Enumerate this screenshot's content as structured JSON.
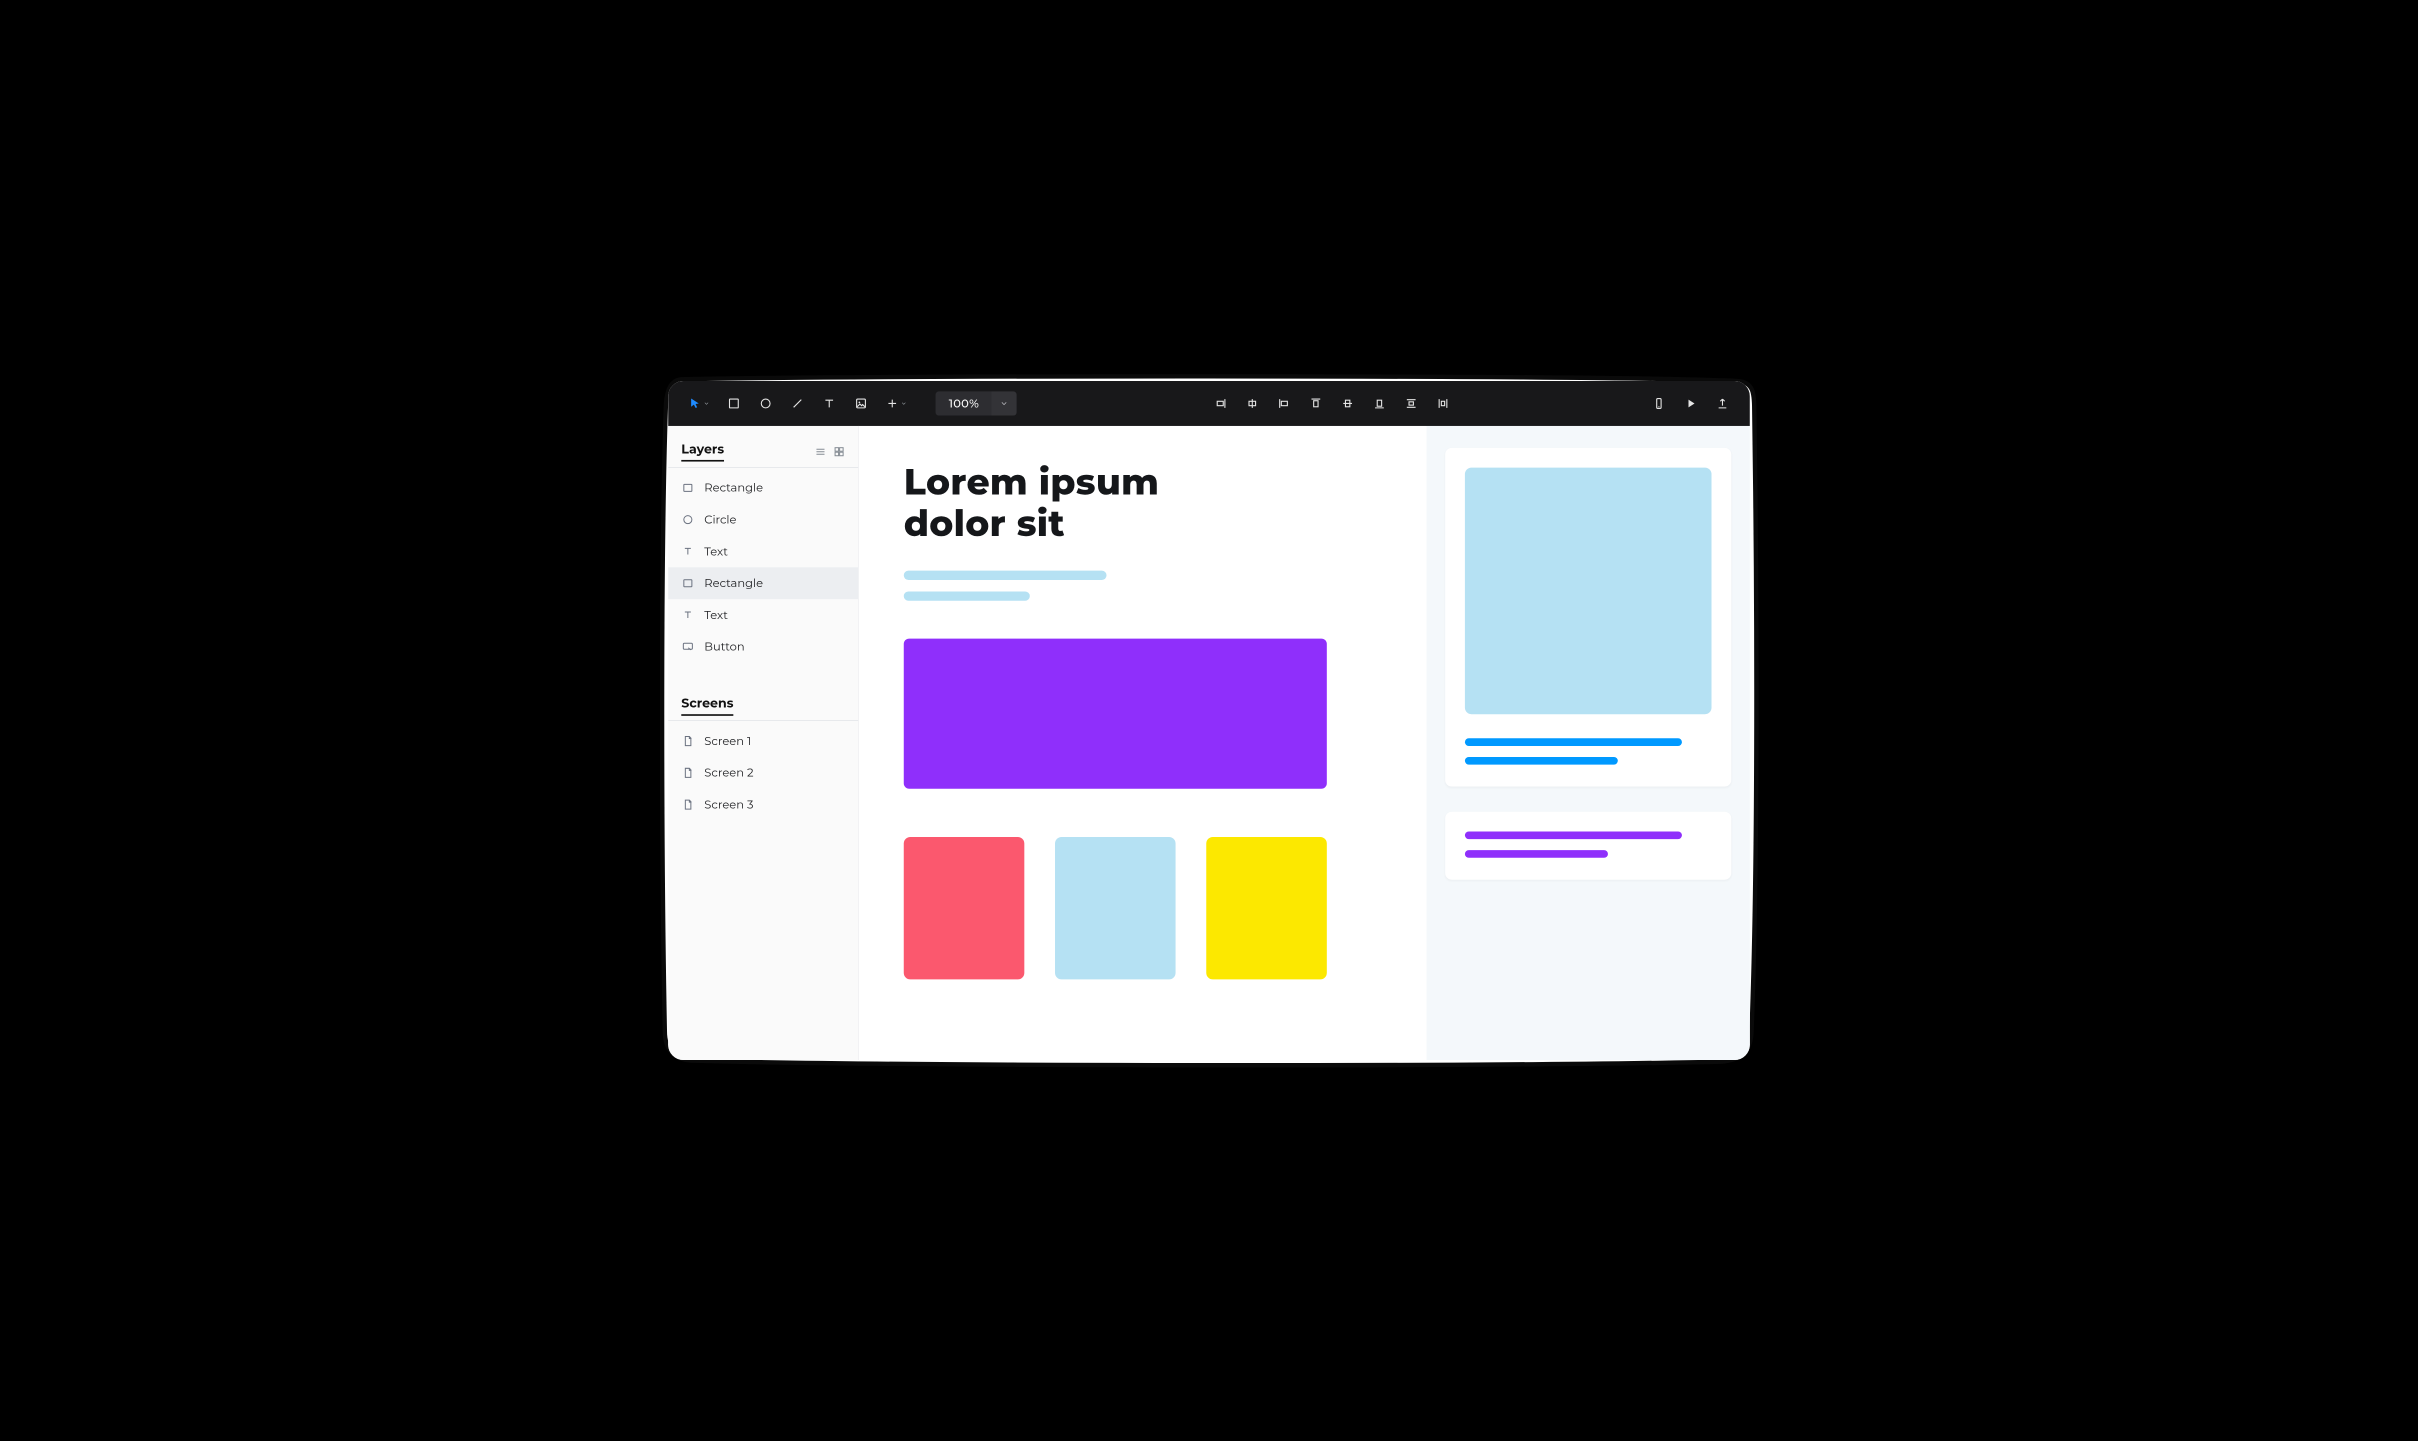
{
  "toolbar": {
    "zoom": "100%",
    "tools": [
      {
        "id": "pointer",
        "key": "pointer-icon",
        "active": true
      },
      {
        "id": "rectangle",
        "key": "rectangle-icon"
      },
      {
        "id": "ellipse",
        "key": "ellipse-icon"
      },
      {
        "id": "line",
        "key": "line-icon"
      },
      {
        "id": "text",
        "key": "text-icon"
      },
      {
        "id": "image",
        "key": "image-icon"
      },
      {
        "id": "add",
        "key": "plus-icon"
      }
    ],
    "align": [
      {
        "id": "align-right",
        "key": "align-right-icon"
      },
      {
        "id": "align-hcenter",
        "key": "align-hcenter-icon"
      },
      {
        "id": "align-left",
        "key": "align-left-icon"
      },
      {
        "id": "align-top",
        "key": "align-top-icon"
      },
      {
        "id": "align-vcenter",
        "key": "align-vcenter-icon"
      },
      {
        "id": "align-bottom",
        "key": "align-bottom-icon"
      },
      {
        "id": "distribute-vertical",
        "key": "distribute-vertical-icon"
      },
      {
        "id": "distribute-horizontal",
        "key": "distribute-hor-icon"
      }
    ],
    "right": [
      {
        "id": "device",
        "key": "device-icon"
      },
      {
        "id": "play",
        "key": "play-icon"
      },
      {
        "id": "export",
        "key": "upload-icon"
      }
    ]
  },
  "sidebar": {
    "layers_label": "Layers",
    "screens_label": "Screens",
    "layers": [
      {
        "type": "rectangle",
        "label": "Rectangle",
        "selected": false
      },
      {
        "type": "circle",
        "label": "Circle",
        "selected": false
      },
      {
        "type": "text",
        "label": "Text",
        "selected": false
      },
      {
        "type": "rectangle",
        "label": "Rectangle",
        "selected": true
      },
      {
        "type": "text",
        "label": "Text",
        "selected": false
      },
      {
        "type": "button",
        "label": "Button",
        "selected": false
      }
    ],
    "screens": [
      {
        "label": "Screen 1"
      },
      {
        "label": "Screen 2"
      },
      {
        "label": "Screen 3"
      }
    ]
  },
  "canvas": {
    "headline": "Lorem ipsum dolor sit",
    "colors": {
      "heroRect": "#8f2ffb",
      "tileA": "#fb586e",
      "tileB": "#b5e1f3",
      "tileC": "#fce800"
    }
  },
  "inspector": {
    "card1": {
      "accent": "#0099ff"
    },
    "card2": {
      "accent": "#8f2ffb"
    }
  }
}
